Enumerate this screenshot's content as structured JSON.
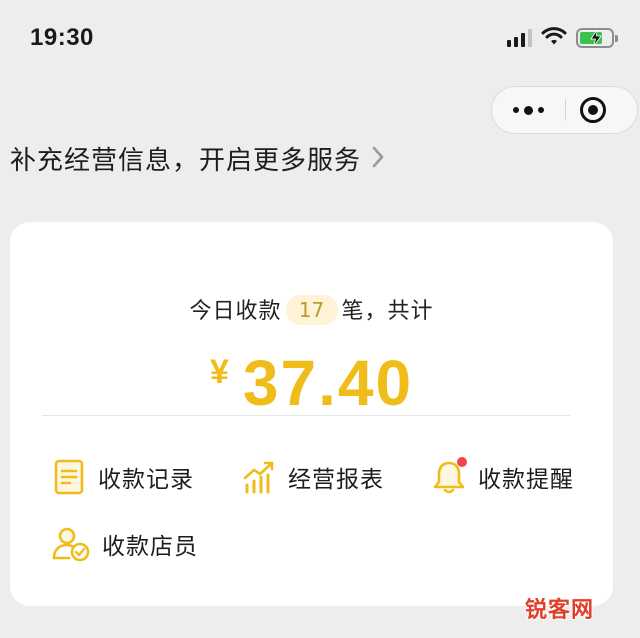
{
  "status_bar": {
    "time": "19:30",
    "icons": [
      "signal-icon",
      "wifi-icon",
      "battery-charging-icon"
    ]
  },
  "capsule": {
    "icons": [
      "more-icon",
      "close-miniprogram-icon"
    ]
  },
  "banner": {
    "text": "补充经营信息，开启更多服务",
    "icon": "chevron-right-icon"
  },
  "summary": {
    "prefix": "今日收款",
    "count": "17",
    "suffix": "笔，共计",
    "currency": "¥",
    "amount": "37.40"
  },
  "menu": {
    "items": [
      {
        "label": "收款记录",
        "icon": "receipt-record-icon"
      },
      {
        "label": "经营报表",
        "icon": "bar-chart-icon"
      },
      {
        "label": "收款提醒",
        "icon": "bell-icon",
        "badge": true
      },
      {
        "label": "收款店员",
        "icon": "staff-verified-icon"
      }
    ]
  },
  "watermark": "锐客网",
  "colors": {
    "accent": "#f0bc1a",
    "count_bg": "#fdf3d6",
    "badge": "#f1444b",
    "background": "#ededed",
    "card": "#ffffff"
  }
}
